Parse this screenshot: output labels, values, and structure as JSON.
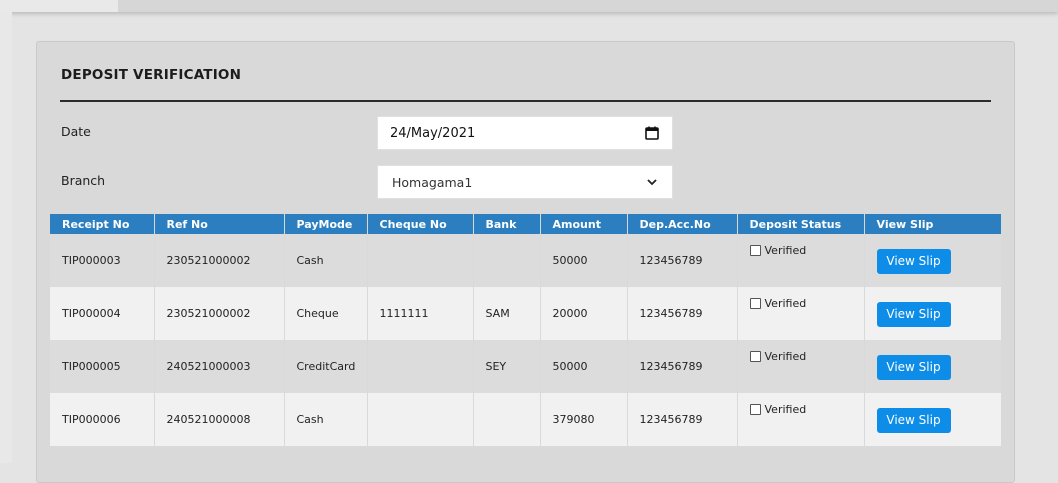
{
  "panel": {
    "title": "DEPOSIT VERIFICATION"
  },
  "form": {
    "date_label": "Date",
    "date_value": "24/May/2021",
    "branch_label": "Branch",
    "branch_value": "Homagama1"
  },
  "table": {
    "columns": [
      "Receipt No",
      "Ref No",
      "PayMode",
      "Cheque No",
      "Bank",
      "Amount",
      "Dep.Acc.No",
      "Deposit Status",
      "View Slip"
    ],
    "rows": [
      {
        "receipt_no": "TIP000003",
        "ref_no": "230521000002",
        "pay_mode": "Cash",
        "cheque_no": "",
        "bank": "",
        "amount": "50000",
        "dep_acc_no": "123456789",
        "status_label": "Verified",
        "verified": false,
        "slip_label": "View Slip"
      },
      {
        "receipt_no": "TIP000004",
        "ref_no": "230521000002",
        "pay_mode": "Cheque",
        "cheque_no": "1111111",
        "bank": "SAM",
        "amount": "20000",
        "dep_acc_no": "123456789",
        "status_label": "Verified",
        "verified": false,
        "slip_label": "View Slip"
      },
      {
        "receipt_no": "TIP000005",
        "ref_no": "240521000003",
        "pay_mode": "CreditCard",
        "cheque_no": "",
        "bank": "SEY",
        "amount": "50000",
        "dep_acc_no": "123456789",
        "status_label": "Verified",
        "verified": false,
        "slip_label": "View Slip"
      },
      {
        "receipt_no": "TIP000006",
        "ref_no": "240521000008",
        "pay_mode": "Cash",
        "cheque_no": "",
        "bank": "",
        "amount": "379080",
        "dep_acc_no": "123456789",
        "status_label": "Verified",
        "verified": false,
        "slip_label": "View Slip"
      }
    ]
  },
  "icons": {
    "date_picker": "calendar-icon",
    "select": "chevron-down-icon"
  },
  "colors": {
    "header_bg": "#2b7fc0",
    "button_bg": "#0d8de8"
  }
}
